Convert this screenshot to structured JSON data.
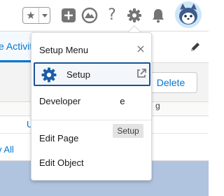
{
  "header": {
    "favorites_star": "★",
    "help_symbol": "?"
  },
  "tabs": {
    "active_label": "e Activit"
  },
  "record": {
    "delete_label": "Delete",
    "column_letter": "g",
    "link_fragment": "U",
    "view_all_fragment": "v All"
  },
  "setup_menu": {
    "title": "Setup Menu",
    "close_symbol": "×",
    "items": [
      {
        "label": "Setup"
      },
      {
        "label": "Developer"
      },
      {
        "label": "e"
      },
      {
        "label": "Edit Page"
      },
      {
        "label": "Edit Object"
      }
    ],
    "tooltip": "Setup"
  },
  "colors": {
    "accent": "#0176d3",
    "focus_border": "#1b5297",
    "icon_gray": "#747474",
    "content_background": "#b0c4df"
  }
}
